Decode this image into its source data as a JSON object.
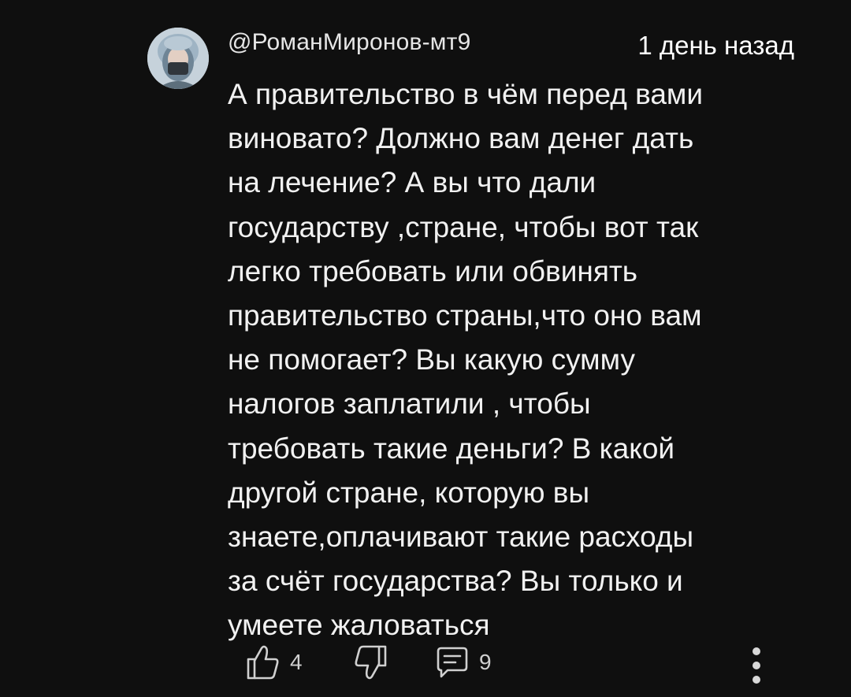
{
  "comment": {
    "author": "@РоманМиронов-мт9",
    "timestamp": "1 день назад",
    "text_lines": [
      "А правительство в чём перед вами",
      "виновато? Должно вам денег дать",
      "на лечение? А вы что дали",
      "государству ,стране, чтобы вот так",
      "легко требовать или обвинять",
      "правительство страны,что оно вам",
      "не помогает? Вы какую сумму",
      "налогов заплатили , чтобы",
      "требовать такие деньги? В какой",
      "другой стране, которую вы",
      "знаете,оплачивают такие расходы",
      "за счёт государства? Вы только и",
      "умеете жаловаться"
    ],
    "likes": "4",
    "replies": "9"
  },
  "icons": {
    "like": "thumbs-up-icon",
    "dislike": "thumbs-down-icon",
    "reply": "comment-icon",
    "more": "more-vertical-icon"
  },
  "colors": {
    "background": "#0f0f0f",
    "text": "#f1f1f1",
    "icon": "#d0d0d0"
  }
}
